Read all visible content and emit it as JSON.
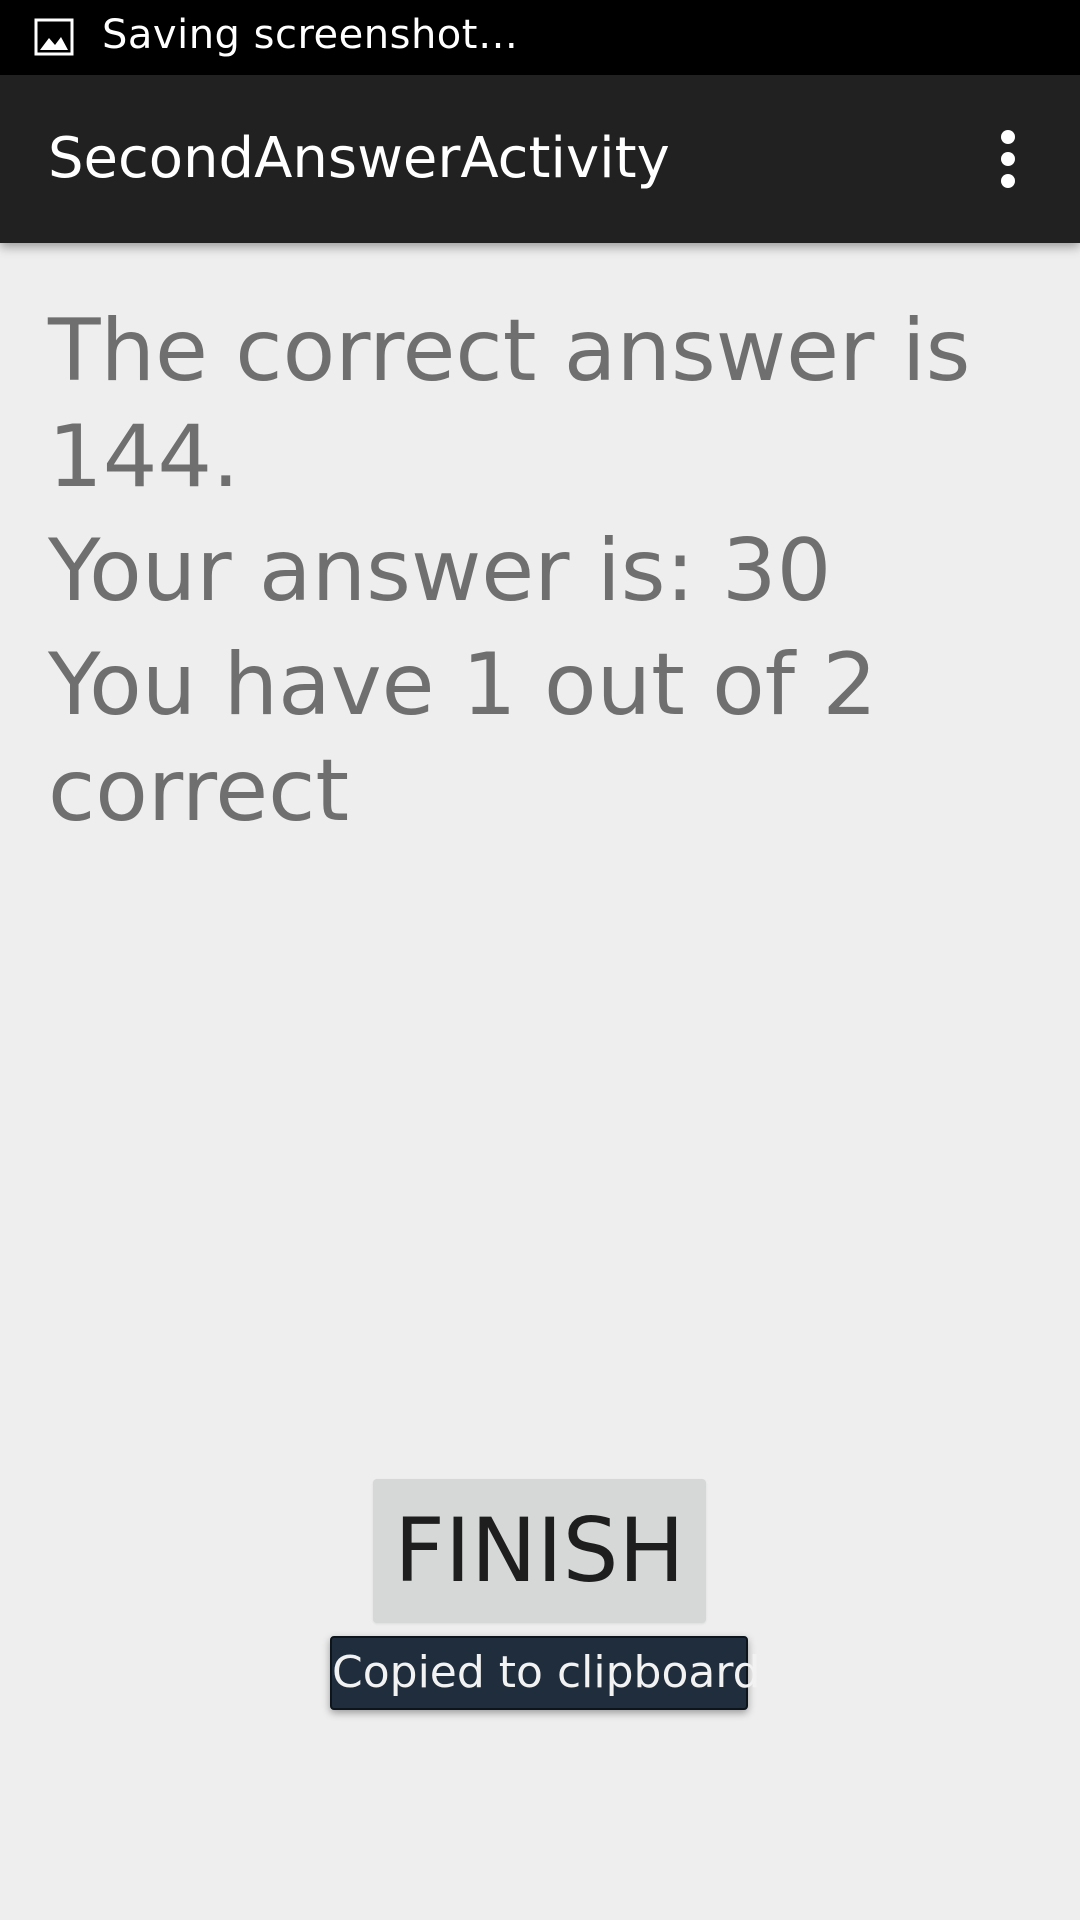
{
  "status_bar": {
    "icon": "image-icon",
    "text": "Saving screenshot…"
  },
  "action_bar": {
    "title": "SecondAnswerActivity",
    "overflow_icon": "more-vert-icon"
  },
  "content": {
    "correct_answer_text": "The correct answer is 144.",
    "your_answer_text": "Your answer is: 30",
    "score_text": "You have 1 out of 2 correct"
  },
  "finish_button": {
    "label": "FINISH"
  },
  "toast": {
    "text": "Copied to clipboard"
  },
  "colors": {
    "status_bar_bg": "#000000",
    "action_bar_bg": "#212121",
    "page_bg": "#eeeeee",
    "body_text": "#6f6f6f",
    "button_bg": "#d6d7d7",
    "toast_bg": "#1f2d3d"
  }
}
